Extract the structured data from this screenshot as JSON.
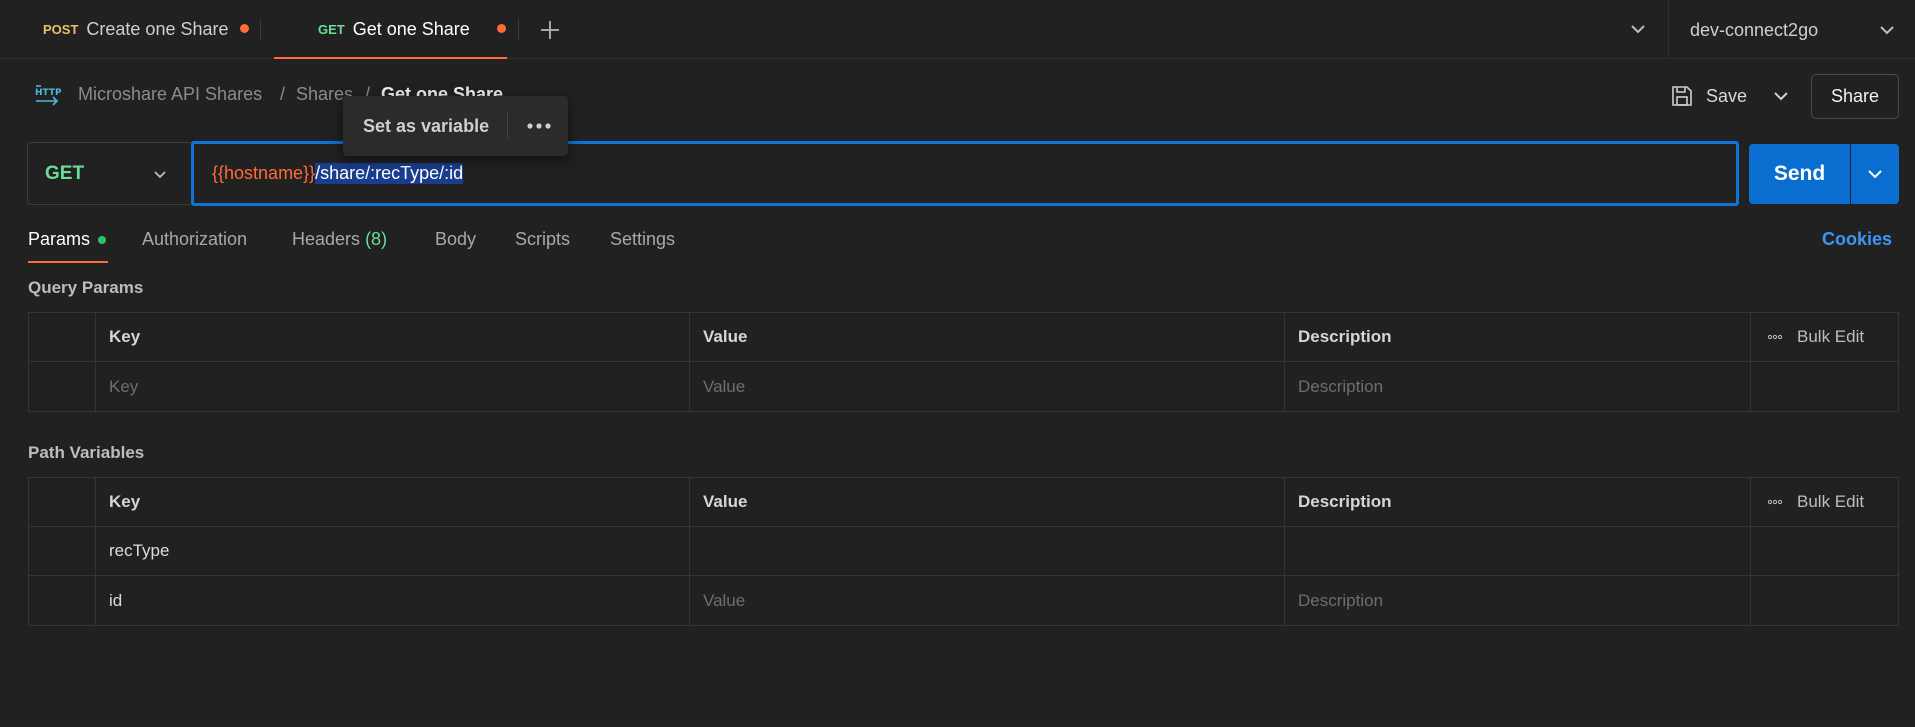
{
  "tabs": [
    {
      "method": "POST",
      "label": "Create one Share",
      "method_color": "#e8c16b"
    },
    {
      "method": "GET",
      "label": "Get one Share",
      "method_color": "#6bdd9a"
    }
  ],
  "environment": "dev-connect2go",
  "breadcrumb": {
    "collection": "Microshare API Shares",
    "sep1": "/",
    "folder": "Shares",
    "sep2": "/",
    "request": "Get one Share"
  },
  "popover": {
    "label": "Set as variable"
  },
  "toolbar": {
    "save_label": "Save",
    "share_label": "Share"
  },
  "request": {
    "method": "GET",
    "url_variable": "{{hostname}}",
    "url_path": "/share/:recType/:id",
    "send_label": "Send"
  },
  "request_tabs": {
    "params": "Params",
    "authorization": "Authorization",
    "headers": "Headers",
    "headers_count": "(8)",
    "body": "Body",
    "scripts": "Scripts",
    "settings": "Settings",
    "cookies": "Cookies"
  },
  "query_params": {
    "title": "Query Params",
    "headers": {
      "key": "Key",
      "value": "Value",
      "description": "Description",
      "bulk_edit": "Bulk Edit"
    },
    "placeholder": {
      "key": "Key",
      "value": "Value",
      "description": "Description"
    }
  },
  "path_variables": {
    "title": "Path Variables",
    "headers": {
      "key": "Key",
      "value": "Value",
      "description": "Description",
      "bulk_edit": "Bulk Edit"
    },
    "rows": [
      {
        "key": "recType",
        "value": "",
        "description": ""
      },
      {
        "key": "id",
        "value_placeholder": "Value",
        "description_placeholder": "Description"
      }
    ]
  },
  "colors": {
    "accent": "#ff6c37",
    "send": "#0a6ed1",
    "get_method": "#6bdd9a",
    "post_method": "#e8c16b",
    "link": "#3b97f5"
  }
}
